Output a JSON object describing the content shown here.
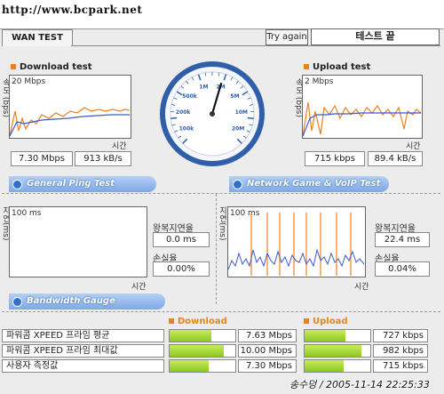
{
  "watermark": "http://www.bcpark.net",
  "signature": "송수덩 / 2005-11-14 22:25:33",
  "tab": {
    "title": "WAN TEST"
  },
  "toolbar": {
    "try_again": "Try again",
    "status": "테스트 끝"
  },
  "download_panel": {
    "title": "Download test",
    "y_label": "속도 (bps)",
    "scale": "20 Mbps",
    "x_label": "시간",
    "value_mbps": "7.30 Mbps",
    "value_kbs": "913 kB/s"
  },
  "upload_panel": {
    "title": "Upload test",
    "y_label": "속도 (bps)",
    "scale": "2 Mbps",
    "x_label": "시간",
    "value_kbps": "715 kbps",
    "value_kbs": "89.4 kB/s"
  },
  "gauge": {
    "labels": [
      "100k",
      "200k",
      "500k",
      "1M",
      "2M",
      "5M",
      "10M",
      "20M"
    ],
    "needle_value": "7.30 Mbps"
  },
  "ping": {
    "title": "General Ping Test",
    "y_label": "지연(ms)",
    "scale": "100 ms",
    "x_label": "시간",
    "latency_label": "왕복지연율",
    "latency_value": "0.0 ms",
    "loss_label": "손실율",
    "loss_value": "0.00%"
  },
  "voip": {
    "title": "Network Game & VoIP Test",
    "y_label": "지연(ms)",
    "scale": "100 ms",
    "x_label": "시간",
    "latency_label": "왕복지연율",
    "latency_value": "22.4 ms",
    "loss_label": "손실율",
    "loss_value": "0.04%"
  },
  "bandwidth": {
    "title": "Bandwidth Gauge",
    "download_header": "Download",
    "upload_header": "Upload",
    "rows": [
      {
        "label": "파워콤 XPEED 프라임 평균",
        "down_value": "7.63 Mbps",
        "down_fill": 0.63,
        "up_value": "727 kbps",
        "up_fill": 0.62
      },
      {
        "label": "파워콤 XPEED 프라임 최대값",
        "down_value": "10.00 Mbps",
        "down_fill": 0.82,
        "up_value": "982 kbps",
        "up_fill": 0.86
      },
      {
        "label": "사용자 측정값",
        "down_value": "7.30 Mbps",
        "down_fill": 0.6,
        "up_value": "715 kbps",
        "up_fill": 0.6
      }
    ]
  },
  "colors": {
    "accent": "#e8821e",
    "series_blue": "#3a5bd0",
    "pill_blue": "#7ea8e6",
    "bar_green": "#8cc820",
    "gauge_rim": "#2e5fa8"
  }
}
